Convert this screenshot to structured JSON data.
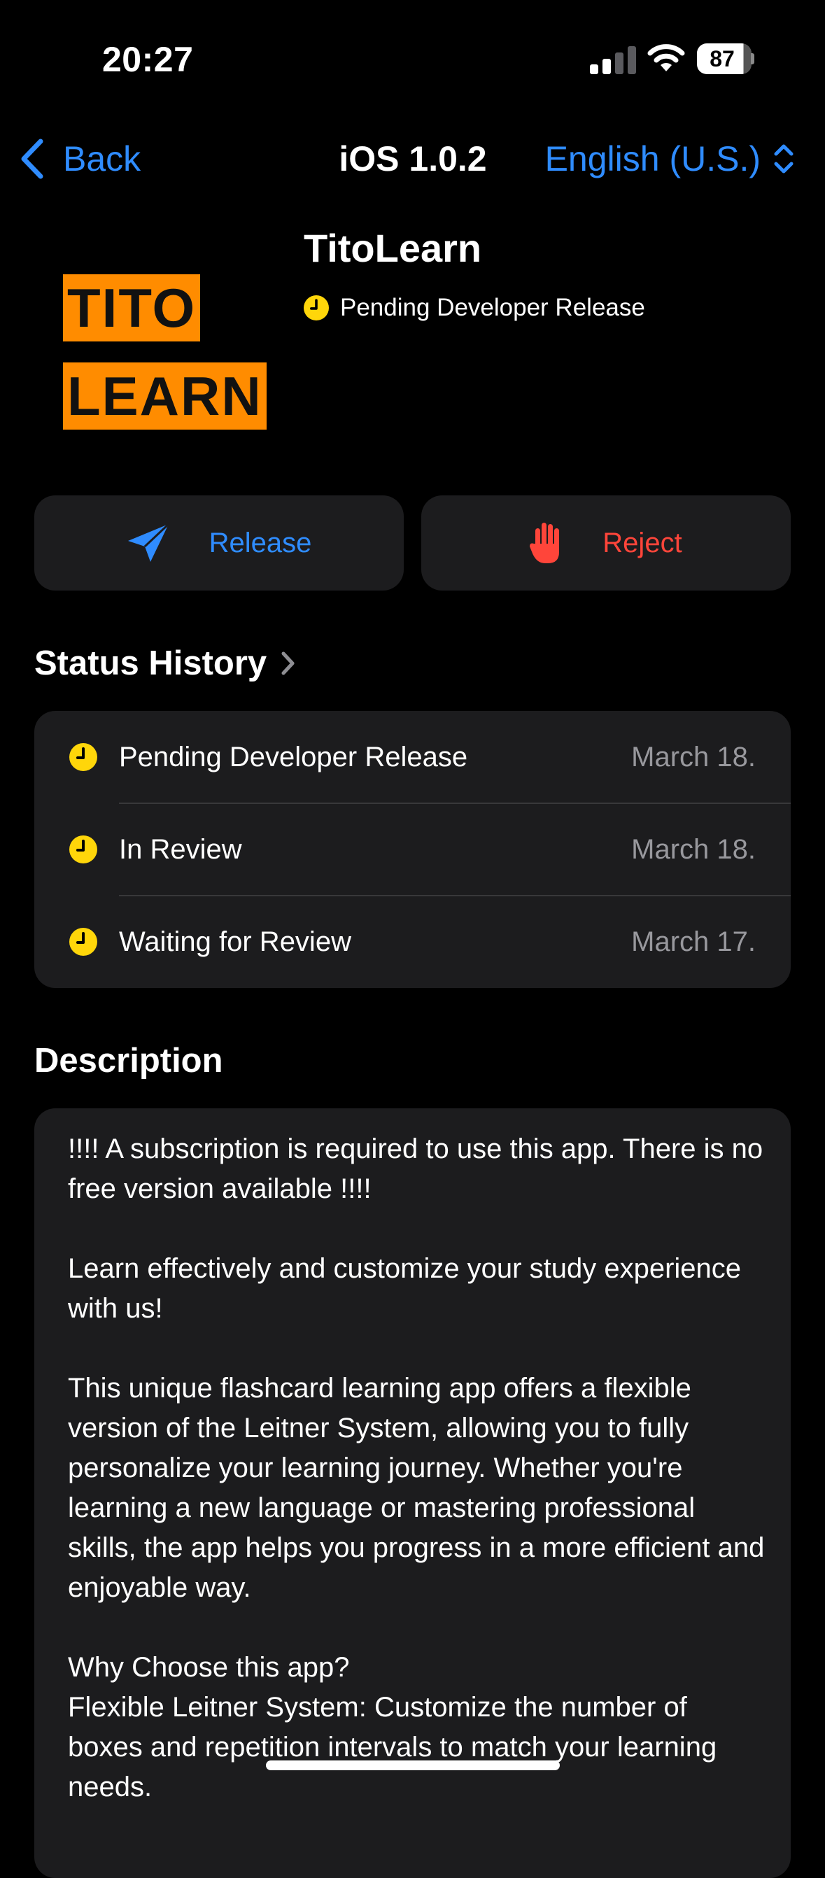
{
  "status_bar": {
    "time": "20:27",
    "battery_level": "87",
    "icons": [
      "signal-icon",
      "wifi-icon",
      "battery-icon"
    ]
  },
  "nav": {
    "back_label": "Back",
    "title": "iOS 1.0.2",
    "language": "English (U.S.)"
  },
  "app": {
    "logo_line1": "TITO",
    "logo_line2": "LEARN",
    "name": "TitoLearn",
    "status": "Pending Developer Release"
  },
  "actions": {
    "release_label": "Release",
    "reject_label": "Reject"
  },
  "status_history": {
    "title": "Status History",
    "items": [
      {
        "label": "Pending Developer Release",
        "date": "March 18."
      },
      {
        "label": "In Review",
        "date": "March 18."
      },
      {
        "label": "Waiting for Review",
        "date": "March 17."
      }
    ]
  },
  "description": {
    "title": "Description",
    "text": "!!!! A subscription is required to use this app. There is no free version available !!!!\n\nLearn effectively and customize your study experience with us!\n\nThis unique flashcard learning app offers a flexible version of the Leitner System, allowing you to fully personalize your learning journey. Whether you're learning a new language or mastering professional skills, the app helps you progress in a more efficient and enjoyable way.\n\nWhy Choose this app?\nFlexible Leitner System: Customize the number of boxes and repetition intervals to match your learning needs."
  },
  "colors": {
    "accent": "#2f8cff",
    "reject": "#ff453a",
    "pending": "#ffd60a",
    "card": "#1c1c1e",
    "logo": "#ff8c00"
  }
}
